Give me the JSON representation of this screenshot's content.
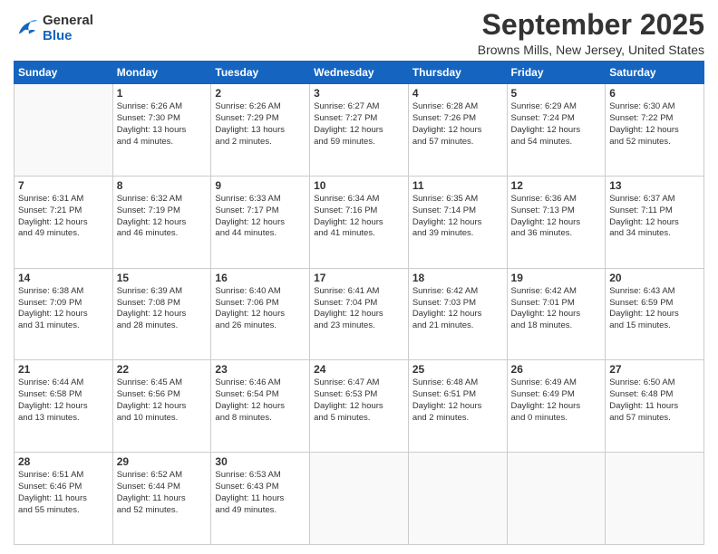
{
  "logo": {
    "line1": "General",
    "line2": "Blue"
  },
  "title": "September 2025",
  "subtitle": "Browns Mills, New Jersey, United States",
  "days_header": [
    "Sunday",
    "Monday",
    "Tuesday",
    "Wednesday",
    "Thursday",
    "Friday",
    "Saturday"
  ],
  "weeks": [
    [
      {
        "day": "",
        "info": ""
      },
      {
        "day": "1",
        "info": "Sunrise: 6:26 AM\nSunset: 7:30 PM\nDaylight: 13 hours\nand 4 minutes."
      },
      {
        "day": "2",
        "info": "Sunrise: 6:26 AM\nSunset: 7:29 PM\nDaylight: 13 hours\nand 2 minutes."
      },
      {
        "day": "3",
        "info": "Sunrise: 6:27 AM\nSunset: 7:27 PM\nDaylight: 12 hours\nand 59 minutes."
      },
      {
        "day": "4",
        "info": "Sunrise: 6:28 AM\nSunset: 7:26 PM\nDaylight: 12 hours\nand 57 minutes."
      },
      {
        "day": "5",
        "info": "Sunrise: 6:29 AM\nSunset: 7:24 PM\nDaylight: 12 hours\nand 54 minutes."
      },
      {
        "day": "6",
        "info": "Sunrise: 6:30 AM\nSunset: 7:22 PM\nDaylight: 12 hours\nand 52 minutes."
      }
    ],
    [
      {
        "day": "7",
        "info": "Sunrise: 6:31 AM\nSunset: 7:21 PM\nDaylight: 12 hours\nand 49 minutes."
      },
      {
        "day": "8",
        "info": "Sunrise: 6:32 AM\nSunset: 7:19 PM\nDaylight: 12 hours\nand 46 minutes."
      },
      {
        "day": "9",
        "info": "Sunrise: 6:33 AM\nSunset: 7:17 PM\nDaylight: 12 hours\nand 44 minutes."
      },
      {
        "day": "10",
        "info": "Sunrise: 6:34 AM\nSunset: 7:16 PM\nDaylight: 12 hours\nand 41 minutes."
      },
      {
        "day": "11",
        "info": "Sunrise: 6:35 AM\nSunset: 7:14 PM\nDaylight: 12 hours\nand 39 minutes."
      },
      {
        "day": "12",
        "info": "Sunrise: 6:36 AM\nSunset: 7:13 PM\nDaylight: 12 hours\nand 36 minutes."
      },
      {
        "day": "13",
        "info": "Sunrise: 6:37 AM\nSunset: 7:11 PM\nDaylight: 12 hours\nand 34 minutes."
      }
    ],
    [
      {
        "day": "14",
        "info": "Sunrise: 6:38 AM\nSunset: 7:09 PM\nDaylight: 12 hours\nand 31 minutes."
      },
      {
        "day": "15",
        "info": "Sunrise: 6:39 AM\nSunset: 7:08 PM\nDaylight: 12 hours\nand 28 minutes."
      },
      {
        "day": "16",
        "info": "Sunrise: 6:40 AM\nSunset: 7:06 PM\nDaylight: 12 hours\nand 26 minutes."
      },
      {
        "day": "17",
        "info": "Sunrise: 6:41 AM\nSunset: 7:04 PM\nDaylight: 12 hours\nand 23 minutes."
      },
      {
        "day": "18",
        "info": "Sunrise: 6:42 AM\nSunset: 7:03 PM\nDaylight: 12 hours\nand 21 minutes."
      },
      {
        "day": "19",
        "info": "Sunrise: 6:42 AM\nSunset: 7:01 PM\nDaylight: 12 hours\nand 18 minutes."
      },
      {
        "day": "20",
        "info": "Sunrise: 6:43 AM\nSunset: 6:59 PM\nDaylight: 12 hours\nand 15 minutes."
      }
    ],
    [
      {
        "day": "21",
        "info": "Sunrise: 6:44 AM\nSunset: 6:58 PM\nDaylight: 12 hours\nand 13 minutes."
      },
      {
        "day": "22",
        "info": "Sunrise: 6:45 AM\nSunset: 6:56 PM\nDaylight: 12 hours\nand 10 minutes."
      },
      {
        "day": "23",
        "info": "Sunrise: 6:46 AM\nSunset: 6:54 PM\nDaylight: 12 hours\nand 8 minutes."
      },
      {
        "day": "24",
        "info": "Sunrise: 6:47 AM\nSunset: 6:53 PM\nDaylight: 12 hours\nand 5 minutes."
      },
      {
        "day": "25",
        "info": "Sunrise: 6:48 AM\nSunset: 6:51 PM\nDaylight: 12 hours\nand 2 minutes."
      },
      {
        "day": "26",
        "info": "Sunrise: 6:49 AM\nSunset: 6:49 PM\nDaylight: 12 hours\nand 0 minutes."
      },
      {
        "day": "27",
        "info": "Sunrise: 6:50 AM\nSunset: 6:48 PM\nDaylight: 11 hours\nand 57 minutes."
      }
    ],
    [
      {
        "day": "28",
        "info": "Sunrise: 6:51 AM\nSunset: 6:46 PM\nDaylight: 11 hours\nand 55 minutes."
      },
      {
        "day": "29",
        "info": "Sunrise: 6:52 AM\nSunset: 6:44 PM\nDaylight: 11 hours\nand 52 minutes."
      },
      {
        "day": "30",
        "info": "Sunrise: 6:53 AM\nSunset: 6:43 PM\nDaylight: 11 hours\nand 49 minutes."
      },
      {
        "day": "",
        "info": ""
      },
      {
        "day": "",
        "info": ""
      },
      {
        "day": "",
        "info": ""
      },
      {
        "day": "",
        "info": ""
      }
    ]
  ]
}
